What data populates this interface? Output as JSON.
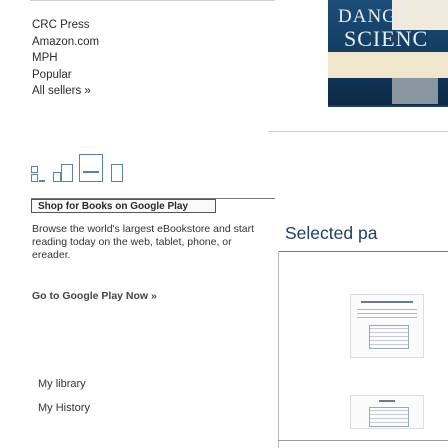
{
  "buy_links": [
    {
      "label": "CRC Press"
    },
    {
      "label": "Amazon.com"
    },
    {
      "label": "MPH"
    },
    {
      "label": "Popular"
    },
    {
      "label": "All sellers »"
    }
  ],
  "view_toggles": [
    "thumbnail-view-icon",
    "single-page-view-icon",
    "two-page-view-icon",
    "full-page-view-icon"
  ],
  "shop": {
    "label": "Shop for Books on Google Play"
  },
  "promo": {
    "text": "Browse the world's largest eBookstore and start reading today on the web, tablet, phone, or ereader.",
    "play_link": "Go to Google Play Now »"
  },
  "nav": {
    "library": "My library",
    "history": "My History"
  },
  "section": {
    "title": "Selected pa"
  },
  "cover": {
    "line1": "DANGL",
    "line2": "SCIENC"
  },
  "colors": {
    "link": "#2b2b2b",
    "toggle": "#5b7fbb",
    "section_title": "#1f3f6c"
  }
}
